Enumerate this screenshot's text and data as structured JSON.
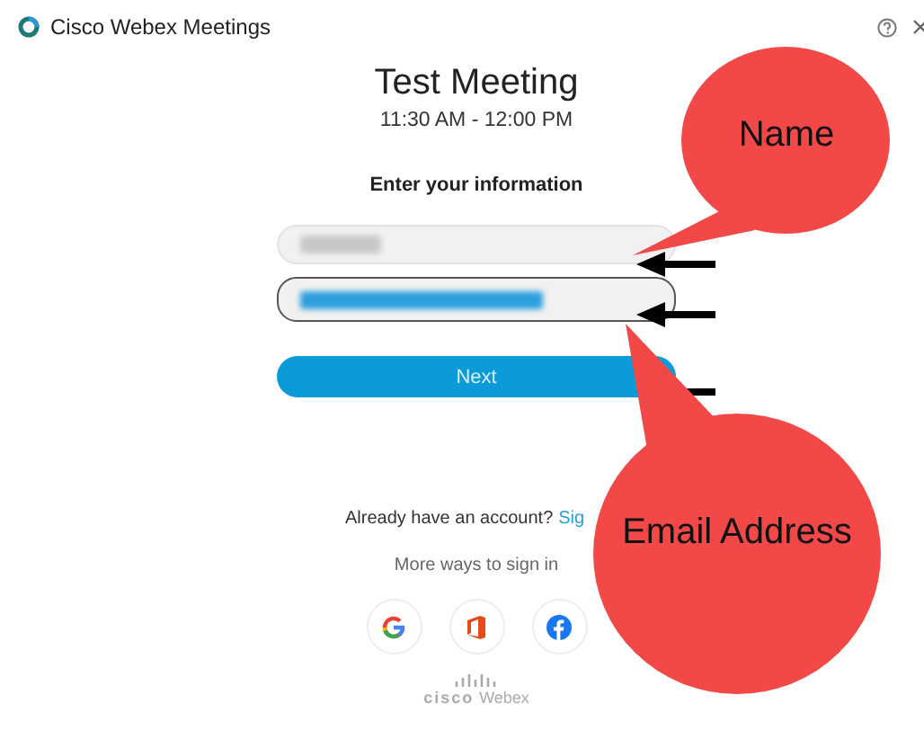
{
  "window": {
    "title": "Cisco Webex Meetings"
  },
  "meeting": {
    "title": "Test Meeting",
    "time": "11:30 AM - 12:00 PM"
  },
  "form": {
    "heading": "Enter your information",
    "fields": [
      {
        "kind": "name",
        "focused": false
      },
      {
        "kind": "email",
        "focused": true
      }
    ],
    "button": "Next"
  },
  "sign_in": {
    "prompt": "Already have an account?",
    "link": "Sig",
    "more": "More ways to sign in",
    "providers": [
      {
        "kind": "google"
      },
      {
        "kind": "office"
      },
      {
        "kind": "facebook"
      }
    ]
  },
  "brand": {
    "top": "cisco",
    "bottom": "Webex"
  },
  "callouts": [
    {
      "kind": "name",
      "text": "Name"
    },
    {
      "kind": "email",
      "text": "Email Address"
    }
  ]
}
